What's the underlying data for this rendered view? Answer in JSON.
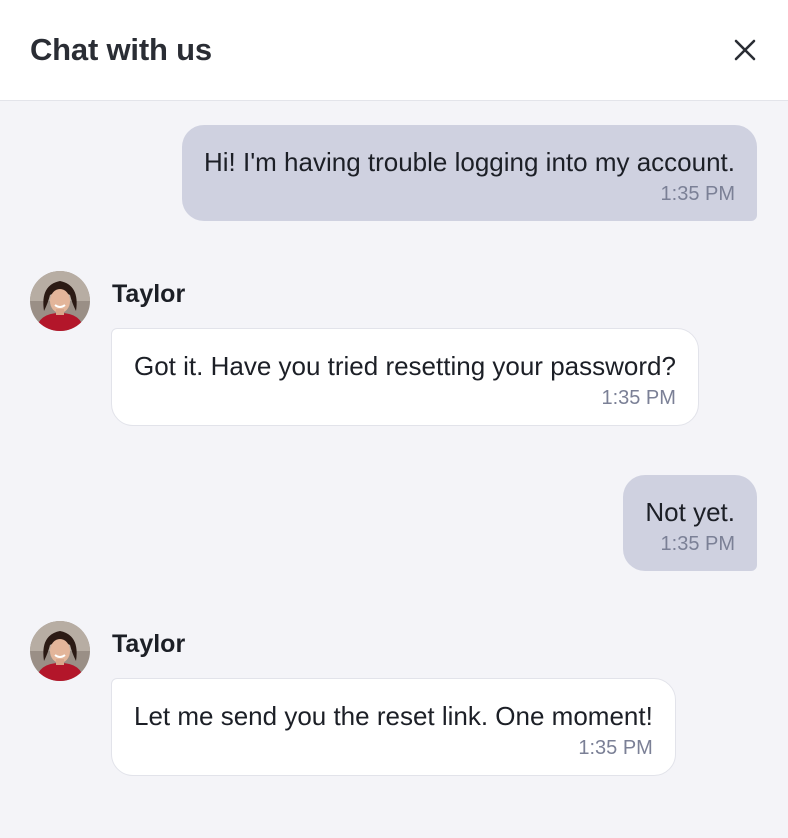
{
  "header": {
    "title": "Chat with us",
    "close_icon": "close-icon"
  },
  "messages": [
    {
      "direction": "outgoing",
      "text": "Hi! I'm having trouble logging into my account.",
      "time": "1:35 PM"
    },
    {
      "direction": "incoming",
      "sender": "Taylor",
      "text": "Got it. Have you tried resetting your password?",
      "time": "1:35 PM"
    },
    {
      "direction": "outgoing",
      "text": "Not yet.",
      "time": "1:35 PM"
    },
    {
      "direction": "incoming",
      "sender": "Taylor",
      "text": "Let me send you the reset link. One moment!",
      "time": "1:35 PM"
    }
  ],
  "colors": {
    "outgoing_bubble": "#cfd1e0",
    "incoming_bubble": "#ffffff",
    "background": "#f4f4f8",
    "timestamp": "#7b8096"
  }
}
